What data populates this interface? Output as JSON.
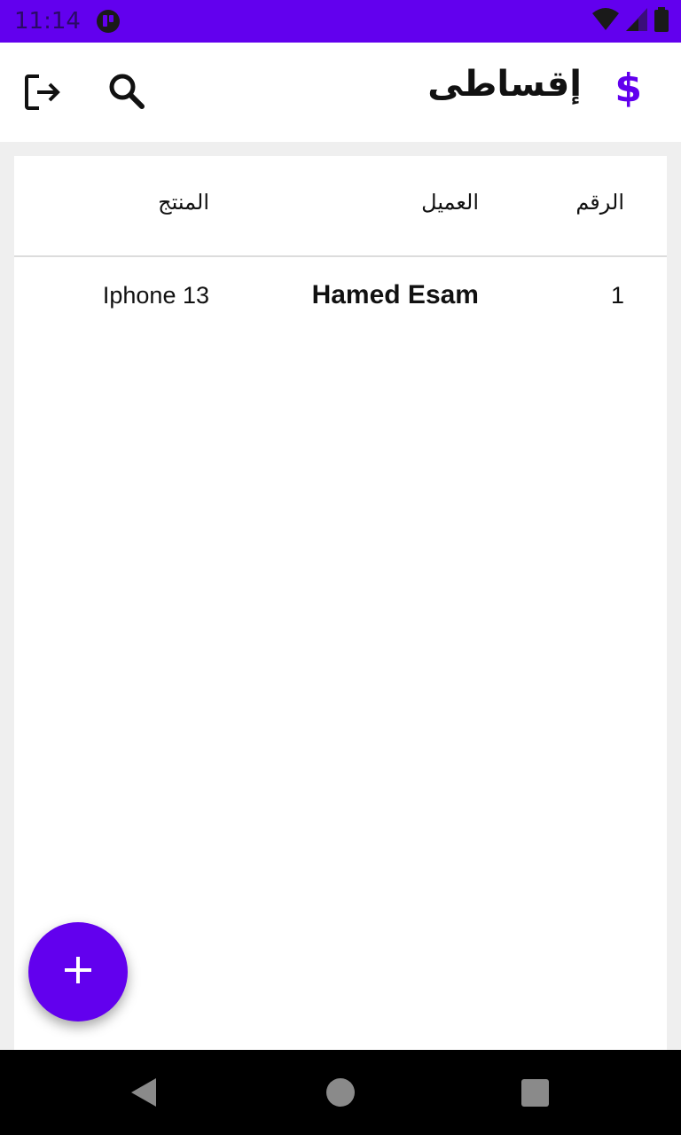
{
  "status_bar": {
    "time": "11:14",
    "icons": [
      "app-notification-icon",
      "wifi-icon",
      "signal-icon",
      "battery-icon"
    ]
  },
  "app_bar": {
    "title": "إقساطى",
    "currency_symbol": "$",
    "actions": [
      "logout-icon",
      "search-icon"
    ],
    "accent_color": "#6200ee"
  },
  "table": {
    "headers": {
      "number": "الرقم",
      "client": "العميل",
      "product": "المنتج"
    },
    "rows": [
      {
        "number": "1",
        "client": "Hamed Esam",
        "product": "Iphone 13"
      }
    ]
  },
  "fab": {
    "icon": "add-icon"
  },
  "navigation_bar": {
    "buttons": [
      "back-icon",
      "home-icon",
      "recent-apps-icon"
    ]
  }
}
